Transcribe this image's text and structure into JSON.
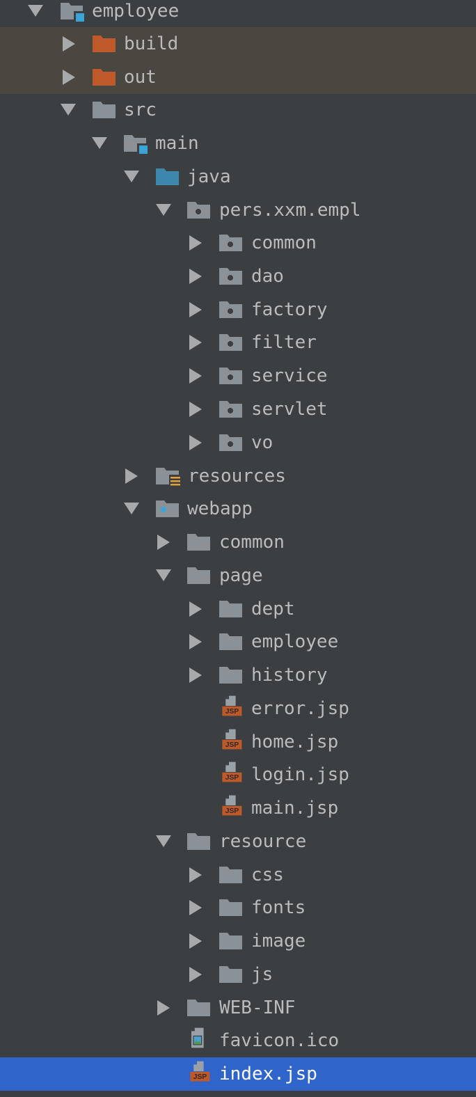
{
  "colors": {
    "background": "#3c3f41",
    "excluded_row": "#4a4640",
    "selected_row": "#2f65ca",
    "text": "#bbbbbb",
    "selected_text": "#ffffff",
    "folder": "#8a9298",
    "excluded_folder": "#c0592a",
    "source_folder": "#3d87ac",
    "module_marker": "#3aa4d6",
    "jsp_badge": "#c0592a",
    "resources_lines": "#e2a13a"
  },
  "tree": {
    "items": [
      {
        "label": "employee",
        "icon": "module-folder-icon",
        "expanded": true
      },
      {
        "label": "build",
        "icon": "excluded-folder-icon",
        "expanded": false
      },
      {
        "label": "out",
        "icon": "excluded-folder-icon",
        "expanded": false
      },
      {
        "label": "src",
        "icon": "folder-icon",
        "expanded": true
      },
      {
        "label": "main",
        "icon": "module-folder-icon",
        "expanded": true
      },
      {
        "label": "java",
        "icon": "source-root-folder-icon",
        "expanded": true
      },
      {
        "label": "pers.xxm.empl",
        "icon": "package-icon",
        "expanded": true
      },
      {
        "label": "common",
        "icon": "package-icon",
        "expanded": false
      },
      {
        "label": "dao",
        "icon": "package-icon",
        "expanded": false
      },
      {
        "label": "factory",
        "icon": "package-icon",
        "expanded": false
      },
      {
        "label": "filter",
        "icon": "package-icon",
        "expanded": false
      },
      {
        "label": "service",
        "icon": "package-icon",
        "expanded": false
      },
      {
        "label": "servlet",
        "icon": "package-icon",
        "expanded": false
      },
      {
        "label": "vo",
        "icon": "package-icon",
        "expanded": false
      },
      {
        "label": "resources",
        "icon": "resources-folder-icon",
        "expanded": false
      },
      {
        "label": "webapp",
        "icon": "web-folder-icon",
        "expanded": true
      },
      {
        "label": "common",
        "icon": "folder-icon",
        "expanded": false
      },
      {
        "label": "page",
        "icon": "folder-icon",
        "expanded": true
      },
      {
        "label": "dept",
        "icon": "folder-icon",
        "expanded": false
      },
      {
        "label": "employee",
        "icon": "folder-icon",
        "expanded": false
      },
      {
        "label": "history",
        "icon": "folder-icon",
        "expanded": false
      },
      {
        "label": "error.jsp",
        "icon": "jsp-file-icon",
        "badge": "JSP"
      },
      {
        "label": "home.jsp",
        "icon": "jsp-file-icon",
        "badge": "JSP"
      },
      {
        "label": "login.jsp",
        "icon": "jsp-file-icon",
        "badge": "JSP"
      },
      {
        "label": "main.jsp",
        "icon": "jsp-file-icon",
        "badge": "JSP"
      },
      {
        "label": "resource",
        "icon": "folder-icon",
        "expanded": true
      },
      {
        "label": "css",
        "icon": "folder-icon",
        "expanded": false
      },
      {
        "label": "fonts",
        "icon": "folder-icon",
        "expanded": false
      },
      {
        "label": "image",
        "icon": "folder-icon",
        "expanded": false
      },
      {
        "label": "js",
        "icon": "folder-icon",
        "expanded": false
      },
      {
        "label": "WEB-INF",
        "icon": "folder-icon",
        "expanded": false
      },
      {
        "label": "favicon.ico",
        "icon": "image-file-icon"
      },
      {
        "label": "index.jsp",
        "icon": "jsp-file-icon",
        "badge": "JSP",
        "selected": true
      }
    ]
  }
}
